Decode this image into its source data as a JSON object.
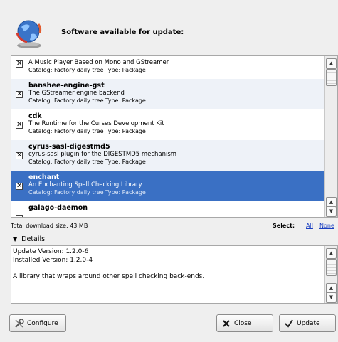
{
  "header": {
    "title": "Software available for update:",
    "icon": "globe-update-icon"
  },
  "packages": [
    {
      "name": "",
      "description": "A Music Player Based on Mono and GStreamer",
      "catalog": "Catalog: Factory daily tree Type: Package",
      "checked": true,
      "selected": false
    },
    {
      "name": "banshee-engine-gst",
      "description": "The GStreamer engine backend",
      "catalog": "Catalog: Factory daily tree Type: Package",
      "checked": true,
      "selected": false
    },
    {
      "name": "cdk",
      "description": "The Runtime for the Curses Development Kit",
      "catalog": "Catalog: Factory daily tree Type: Package",
      "checked": true,
      "selected": false
    },
    {
      "name": "cyrus-sasl-digestmd5",
      "description": "cyrus-sasl plugin for the DIGESTMD5 mechanism",
      "catalog": "Catalog: Factory daily tree Type: Package",
      "checked": true,
      "selected": false
    },
    {
      "name": "enchant",
      "description": "An Enchanting Spell Checking Library",
      "catalog": "Catalog: Factory daily tree Type: Package",
      "checked": true,
      "selected": true
    },
    {
      "name": "galago-daemon",
      "description": "",
      "catalog": "",
      "checked": false,
      "selected": false
    }
  ],
  "summary": {
    "total": "Total download size: 43 MB",
    "select_label": "Select:",
    "select_all": "All",
    "select_none": "None"
  },
  "details": {
    "toggle_label": "Details",
    "text": "Update Version: 1.2.0-6\nInstalled Version: 1.2.0-4\n\nA library that wraps around other spell checking back-ends."
  },
  "buttons": {
    "configure": "Configure",
    "close": "Close",
    "update": "Update"
  },
  "colors": {
    "selection": "#3a70c4",
    "link": "#1a3fc1",
    "background": "#efefef"
  }
}
